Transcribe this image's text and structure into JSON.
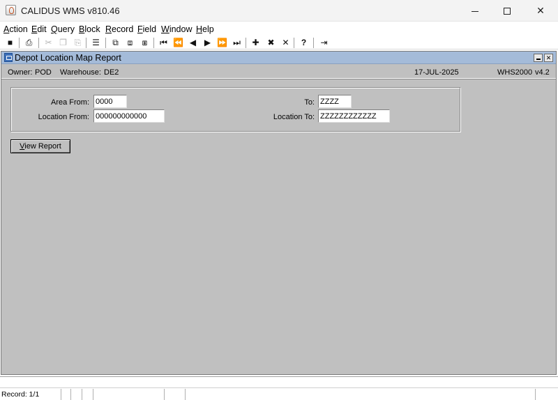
{
  "app": {
    "title": "CALIDUS WMS v810.46",
    "window_controls": {
      "minimize": "minimize-icon",
      "maximize": "maximize-icon",
      "close": "close-icon"
    }
  },
  "menu": [
    {
      "accel": "A",
      "rest": "ction"
    },
    {
      "accel": "E",
      "rest": "dit"
    },
    {
      "accel": "Q",
      "rest": "uery"
    },
    {
      "accel": "B",
      "rest": "lock"
    },
    {
      "accel": "R",
      "rest": "ecord"
    },
    {
      "accel": "F",
      "rest": "ield"
    },
    {
      "accel": "W",
      "rest": "indow"
    },
    {
      "accel": "H",
      "rest": "elp"
    }
  ],
  "toolbar": {
    "icons": [
      "save-icon",
      "print-icon",
      "cut-icon",
      "copy-icon",
      "paste-icon",
      "list-icon",
      "enter-query-icon",
      "execute-query-icon",
      "cancel-query-icon",
      "first-record-icon",
      "previous-block-icon",
      "previous-record-icon",
      "next-record-icon",
      "next-block-icon",
      "last-record-icon",
      "insert-record-icon",
      "delete-record-icon",
      "clear-record-icon",
      "help-icon",
      "exit-icon"
    ],
    "glyphs": {
      "save": "■",
      "print": "⎙",
      "cut": "✂",
      "copy": "❐",
      "paste": "⎘",
      "list": "☰",
      "enter_query": "⧉",
      "execute_query": "⧈",
      "cancel_query": "⧆",
      "first": "⏮",
      "prev_block": "⏪",
      "prev": "◀",
      "next": "▶",
      "next_block": "⏩",
      "last": "⏭",
      "insert": "✚",
      "delete": "✖",
      "clear": "✕",
      "help": "?",
      "exit": "⇥"
    }
  },
  "form": {
    "title": "Depot Location Map Report",
    "info": {
      "owner_label": "Owner:",
      "owner_value": "POD",
      "warehouse_label": "Warehouse:",
      "warehouse_value": "DE2",
      "date": "17-JUL-2025",
      "module": "WHS2000",
      "version": "v4.2"
    },
    "fields": {
      "area_from_label": "Area From:",
      "area_from_value": "0000",
      "area_to_label": "To:",
      "area_to_value": "ZZZZ",
      "location_from_label": "Location From:",
      "location_from_value": "000000000000",
      "location_to_label": "Location To:",
      "location_to_value": "ZZZZZZZZZZZZ"
    },
    "button": {
      "accel": "V",
      "rest": "iew Report"
    }
  },
  "status": {
    "record": "Record: 1/1"
  }
}
